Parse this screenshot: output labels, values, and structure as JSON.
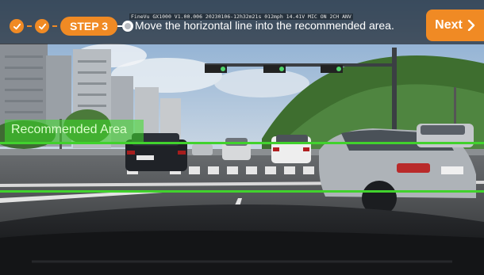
{
  "wizard": {
    "step_label": "STEP 3",
    "osd_text": "FineVu GX1000 V1.00.006  20230106-12h32m21s  012mph 14.41V MIC ON 2CH ANV",
    "instruction": "Move the horizontal line into the recommended area.",
    "next_label": "Next",
    "next_icon": "chevron-right-icon",
    "completed_step_icon": "check-icon",
    "current_step_icon": "radio-dot-icon"
  },
  "overlay": {
    "recommended_area_label": "Recommended Area"
  },
  "colors": {
    "accent": "#f08a24",
    "guide_line": "#41d22d",
    "recommended_fill": "#3cdc28"
  }
}
